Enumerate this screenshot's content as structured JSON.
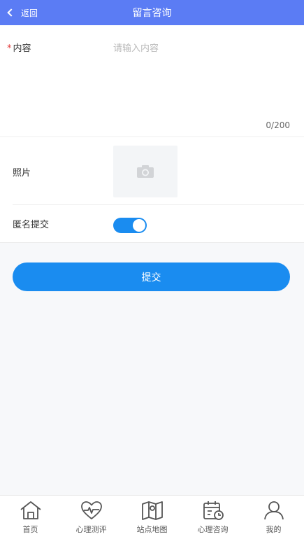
{
  "header": {
    "back_label": "返回",
    "title": "留言咨询"
  },
  "form": {
    "content_required_mark": "*",
    "content_label": "内容",
    "content_placeholder": "请输入内容",
    "content_value": "",
    "counter": "0/200",
    "photo_label": "照片",
    "photo_icon": "camera-icon",
    "anonymous_label": "匿名提交",
    "anonymous_enabled": true
  },
  "submit_label": "提交",
  "colors": {
    "header_bg": "#5b7cf4",
    "accent": "#1a8cf0",
    "required": "#e23b3b"
  },
  "tabbar": {
    "items": [
      {
        "label": "首页",
        "icon": "home-icon"
      },
      {
        "label": "心理测评",
        "icon": "heart-pulse-icon"
      },
      {
        "label": "站点地图",
        "icon": "map-icon"
      },
      {
        "label": "心理咨询",
        "icon": "calendar-clock-icon"
      },
      {
        "label": "我的",
        "icon": "user-icon"
      }
    ]
  }
}
